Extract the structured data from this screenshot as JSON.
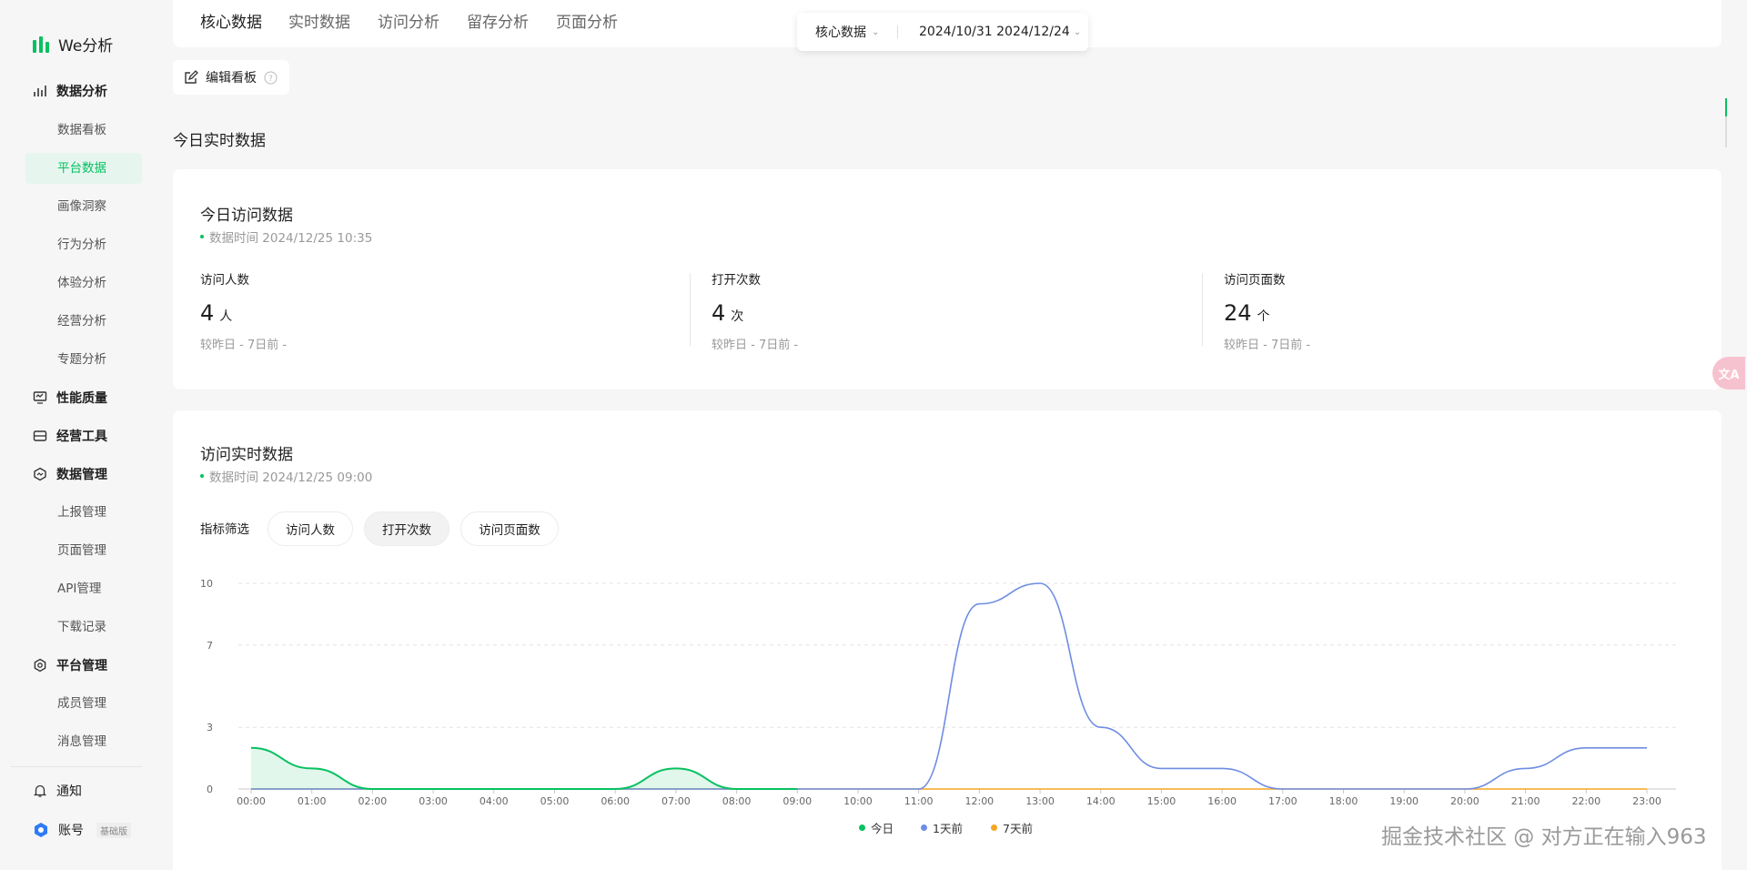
{
  "app": {
    "logo_text": "We分析"
  },
  "sidebar": {
    "groups": [
      {
        "label": "数据分析",
        "icon": "bar-chart-icon"
      },
      {
        "label": "性能质量",
        "icon": "monitor-icon"
      },
      {
        "label": "经营工具",
        "icon": "briefcase-icon"
      },
      {
        "label": "数据管理",
        "icon": "hexagon-icon"
      },
      {
        "label": "平台管理",
        "icon": "gear-icon"
      }
    ],
    "items": [
      "数据看板",
      "平台数据",
      "画像洞察",
      "行为分析",
      "体验分析",
      "经营分析",
      "专题分析"
    ],
    "data_mgmt_items": [
      "上报管理",
      "页面管理",
      "API管理",
      "下载记录"
    ],
    "platform_items": [
      "成员管理",
      "消息管理"
    ],
    "active_item": "平台数据",
    "notify_label": "通知",
    "account_label": "账号",
    "account_badge": "基础版"
  },
  "topbar": {
    "tabs": [
      "核心数据",
      "实时数据",
      "访问分析",
      "留存分析",
      "页面分析"
    ],
    "active_tab": "核心数据"
  },
  "filter": {
    "category": "核心数据",
    "date_range": "2024/10/31 2024/12/24"
  },
  "edit_board": {
    "label": "编辑看板"
  },
  "section": {
    "title": "今日实时数据"
  },
  "today_card": {
    "title": "今日访问数据",
    "time": "数据时间 2024/12/25 10:35",
    "metrics": [
      {
        "label": "访问人数",
        "value": "4",
        "unit": "人",
        "compare": "较昨日 -    7日前 -"
      },
      {
        "label": "打开次数",
        "value": "4",
        "unit": "次",
        "compare": "较昨日 -    7日前 -"
      },
      {
        "label": "访问页面数",
        "value": "24",
        "unit": "个",
        "compare": "较昨日 -    7日前 -"
      }
    ]
  },
  "realtime_card": {
    "title": "访问实时数据",
    "time": "数据时间 2024/12/25 09:00",
    "filter_label": "指标筛选",
    "chips": [
      "访问人数",
      "打开次数",
      "访问页面数"
    ],
    "selected_chip": "打开次数"
  },
  "chart_data": {
    "type": "line",
    "x": [
      "00:00",
      "01:00",
      "02:00",
      "03:00",
      "04:00",
      "05:00",
      "06:00",
      "07:00",
      "08:00",
      "09:00",
      "10:00",
      "11:00",
      "12:00",
      "13:00",
      "14:00",
      "15:00",
      "16:00",
      "17:00",
      "18:00",
      "19:00",
      "20:00",
      "21:00",
      "22:00",
      "23:00"
    ],
    "ylim": [
      0,
      10
    ],
    "yticks": [
      0,
      3,
      7,
      10
    ],
    "grid": true,
    "legend": "bottom",
    "series": [
      {
        "name": "今日",
        "color": "#07c160",
        "values": [
          2,
          1,
          0,
          0,
          0,
          0,
          0,
          1,
          0,
          0,
          null,
          null,
          null,
          null,
          null,
          null,
          null,
          null,
          null,
          null,
          null,
          null,
          null,
          null
        ]
      },
      {
        "name": "1天前",
        "color": "#6e8de2",
        "values": [
          0,
          0,
          0,
          0,
          0,
          0,
          0,
          0,
          0,
          0,
          0,
          0,
          9,
          10,
          3,
          1,
          1,
          0,
          0,
          0,
          0,
          1,
          2,
          2
        ]
      },
      {
        "name": "7天前",
        "color": "#f5a623",
        "values": [
          0,
          0,
          0,
          0,
          0,
          0,
          0,
          0,
          0,
          0,
          0,
          0,
          0,
          0,
          0,
          0,
          0,
          0,
          0,
          0,
          0,
          0,
          0,
          0
        ]
      }
    ]
  },
  "watermark": "掘金技术社区 @ 对方正在输入963",
  "translate_pill": "文A"
}
